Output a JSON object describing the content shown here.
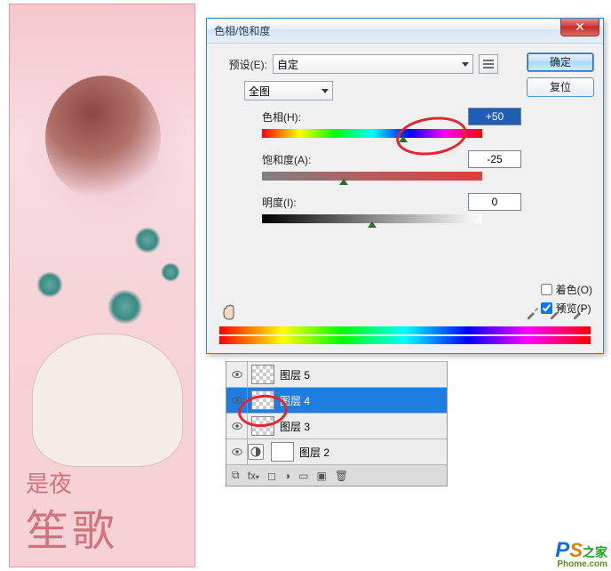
{
  "artwork": {
    "line1": "是夜",
    "line2": "笙歌"
  },
  "dialog": {
    "title": "色相/饱和度",
    "preset_label": "预设(E):",
    "preset_value": "自定",
    "ok": "确定",
    "reset": "复位",
    "channel": "全图",
    "hue_label": "色相(H):",
    "hue_value": "+50",
    "sat_label": "饱和度(A):",
    "sat_value": "-25",
    "lig_label": "明度(I):",
    "lig_value": "0",
    "colorize": "着色(O)",
    "preview": "预览(P)"
  },
  "layers": {
    "items": [
      {
        "name": "图层 5",
        "adjust": false,
        "selected": false
      },
      {
        "name": "图层 4",
        "adjust": false,
        "selected": true
      },
      {
        "name": "图层 3",
        "adjust": false,
        "selected": false
      },
      {
        "name": "图层 2",
        "adjust": true,
        "selected": false
      }
    ]
  },
  "watermark": {
    "p": "P",
    "s": "S",
    "rest": "之家",
    "domain": "Phome.com"
  }
}
